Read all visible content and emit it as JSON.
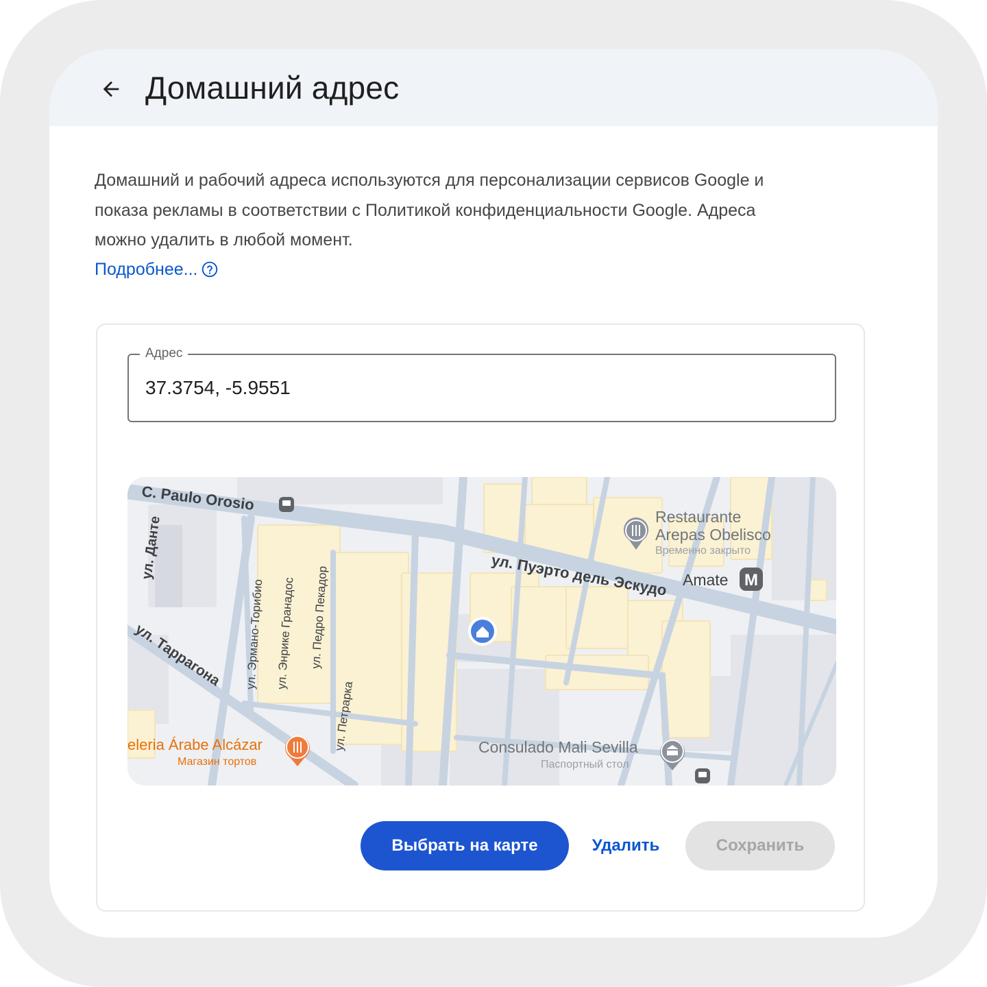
{
  "header": {
    "title": "Домашний адрес",
    "back_icon": "arrow-left-icon"
  },
  "description": {
    "text": "Домашний и рабочий адреса используются для персонализации сервисов Google и показа рекламы в соответствии с Политикой конфиденциальности Google. Адреса можно удалить в любой момент.",
    "learn_more": "Подробнее...",
    "help_icon": "help-circle-icon"
  },
  "address_field": {
    "label": "Адрес",
    "value": "37.3754, -5.9551"
  },
  "map": {
    "streets": {
      "paulo_orosio": "C. Paulo Orosio",
      "dante": "ул. Данте",
      "puerto_del_escudo": "ул. Пуэрто дель Эскудо",
      "tarragona": "ул. Таррагона",
      "hermano_toribio": "ул. Эрмано-Торибио",
      "enrique_granados": "ул. Энрике Гранадос",
      "pedro_pecador": "ул. Педро Пекадор",
      "petrarca": "ул. Петрарка"
    },
    "places": {
      "restaurant_name_1": "Restaurante",
      "restaurant_name_2": "Arepas Obelisco",
      "restaurant_status": "Временно закрыто",
      "metro": "Amate",
      "metro_letter": "M",
      "bakery_name": "eleria Árabe Alcázar",
      "bakery_type": "Магазин тортов",
      "consulate_name": "Consulado Mali Sevilla",
      "consulate_type": "Паспортный стол"
    },
    "colors": {
      "road": "#c6d2e0",
      "building": "#fbf1d3",
      "block": "#e4e6ea",
      "home_pin": "#4a7fdc",
      "food_pin": "#ee7b3c",
      "grey_pin": "#8b929c"
    }
  },
  "actions": {
    "pick_on_map": "Выбрать на карте",
    "delete": "Удалить",
    "save": "Сохранить"
  }
}
